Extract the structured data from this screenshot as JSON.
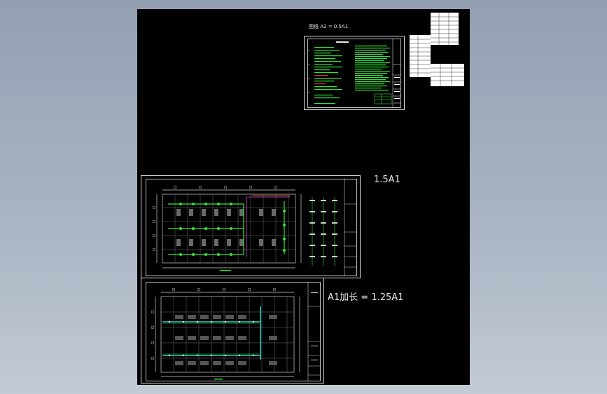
{
  "canvas": {
    "background": "#000000",
    "line_color": "#d9d9d9",
    "green": "#33e633",
    "cyan": "#33cccc"
  },
  "sheets": {
    "notes": {
      "header": "图纸  A2 = 0.5A1"
    },
    "plan_a": {
      "scale_label": "1.5A1"
    },
    "plan_b": {
      "scale_label": "A1加长 = 1.25A1"
    }
  }
}
